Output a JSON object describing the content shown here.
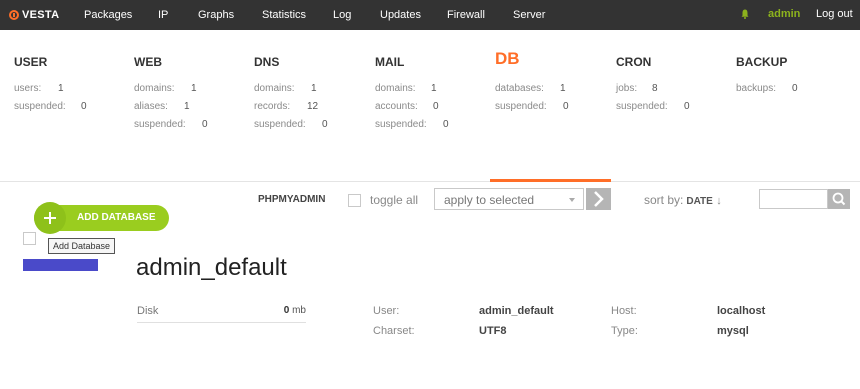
{
  "header": {
    "logo": "VESTA",
    "nav": [
      {
        "label": "Packages"
      },
      {
        "label": "IP"
      },
      {
        "label": "Graphs"
      },
      {
        "label": "Statistics"
      },
      {
        "label": "Log"
      },
      {
        "label": "Updates"
      },
      {
        "label": "Firewall"
      },
      {
        "label": "Server"
      }
    ],
    "user": "admin",
    "logout": "Log out",
    "accent_color": "#ff6e28",
    "user_color": "#8cb21d"
  },
  "stats": [
    {
      "title": "USER",
      "rows": [
        {
          "k": "users:",
          "v": "1"
        },
        {
          "k": "suspended:",
          "v": "0"
        }
      ]
    },
    {
      "title": "WEB",
      "rows": [
        {
          "k": "domains:",
          "v": "1"
        },
        {
          "k": "aliases:",
          "v": "1"
        },
        {
          "k": "suspended:",
          "v": "0"
        }
      ]
    },
    {
      "title": "DNS",
      "rows": [
        {
          "k": "domains:",
          "v": "1"
        },
        {
          "k": "records:",
          "v": "12"
        },
        {
          "k": "suspended:",
          "v": "0"
        }
      ]
    },
    {
      "title": "MAIL",
      "rows": [
        {
          "k": "domains:",
          "v": "1"
        },
        {
          "k": "accounts:",
          "v": "0"
        },
        {
          "k": "suspended:",
          "v": "0"
        }
      ]
    },
    {
      "title": "DB",
      "active": true,
      "rows": [
        {
          "k": "databases:",
          "v": "1"
        },
        {
          "k": "suspended:",
          "v": "0"
        }
      ]
    },
    {
      "title": "CRON",
      "rows": [
        {
          "k": "jobs:",
          "v": "8"
        },
        {
          "k": "suspended:",
          "v": "0"
        }
      ]
    },
    {
      "title": "BACKUP",
      "rows": [
        {
          "k": "backups:",
          "v": "0"
        }
      ]
    }
  ],
  "toolbar": {
    "phpmyadmin": "PHPMYADMIN",
    "toggle_all": "toggle all",
    "apply_placeholder": "apply to selected",
    "sort_label": "sort by:",
    "sort_value": "DATE",
    "sort_dir": "↓",
    "search_value": ""
  },
  "add_button": {
    "label": "ADD DATABASE",
    "tooltip": "Add Database",
    "color": "#9acd1f"
  },
  "database": {
    "name": "admin_default",
    "color": "#4a4ac9",
    "disk_label": "Disk",
    "disk_value": "0",
    "disk_unit": "mb",
    "user_label": "User:",
    "user_value": "admin_default",
    "charset_label": "Charset:",
    "charset_value": "UTF8",
    "host_label": "Host:",
    "host_value": "localhost",
    "type_label": "Type:",
    "type_value": "mysql"
  }
}
